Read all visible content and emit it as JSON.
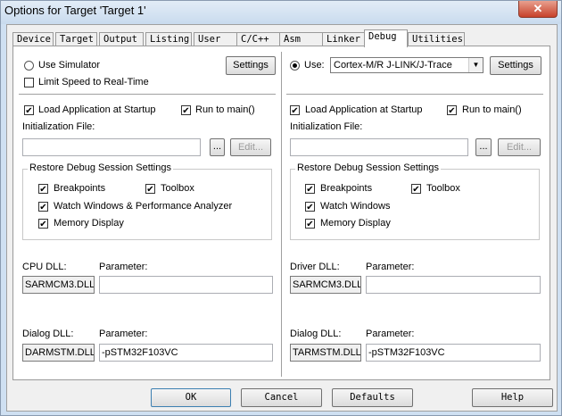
{
  "window": {
    "title": "Options for Target 'Target 1'",
    "close": "✕"
  },
  "tabs": [
    "Device",
    "Target",
    "Output",
    "Listing",
    "User",
    "C/C++",
    "Asm",
    "Linker",
    "Debug",
    "Utilities"
  ],
  "active_tab": "Debug",
  "left": {
    "use_simulator": "Use Simulator",
    "use_simulator_selected": false,
    "settings": "Settings",
    "limit_speed": "Limit Speed to Real-Time",
    "limit_speed_checked": false,
    "load_app": "Load Application at Startup",
    "load_app_checked": true,
    "run_to_main": "Run to main()",
    "run_to_main_checked": true,
    "init_file_label": "Initialization File:",
    "init_file_value": "",
    "browse": "...",
    "edit": "Edit...",
    "restore_title": "Restore Debug Session Settings",
    "breakpoints": "Breakpoints",
    "toolbox": "Toolbox",
    "watch": "Watch Windows & Performance Analyzer",
    "memory": "Memory Display",
    "dll1_label": "CPU DLL:",
    "param_label": "Parameter:",
    "dll1_value": "SARMCM3.DLL",
    "dll1_param": "",
    "dll2_label": "Dialog DLL:",
    "dll2_value": "DARMSTM.DLL",
    "dll2_param": "-pSTM32F103VC"
  },
  "right": {
    "use": "Use:",
    "use_selected": true,
    "debugger": "Cortex-M/R J-LINK/J-Trace",
    "settings": "Settings",
    "load_app": "Load Application at Startup",
    "load_app_checked": true,
    "run_to_main": "Run to main()",
    "run_to_main_checked": true,
    "init_file_label": "Initialization File:",
    "init_file_value": "",
    "browse": "...",
    "edit": "Edit...",
    "restore_title": "Restore Debug Session Settings",
    "breakpoints": "Breakpoints",
    "toolbox": "Toolbox",
    "watch": "Watch Windows",
    "memory": "Memory Display",
    "dll1_label": "Driver DLL:",
    "param_label": "Parameter:",
    "dll1_value": "SARMCM3.DLL",
    "dll1_param": "",
    "dll2_label": "Dialog DLL:",
    "dll2_value": "TARMSTM.DLL",
    "dll2_param": "-pSTM32F103VC"
  },
  "buttons": {
    "ok": "OK",
    "cancel": "Cancel",
    "defaults": "Defaults",
    "help": "Help"
  },
  "check_glyph": "✔"
}
